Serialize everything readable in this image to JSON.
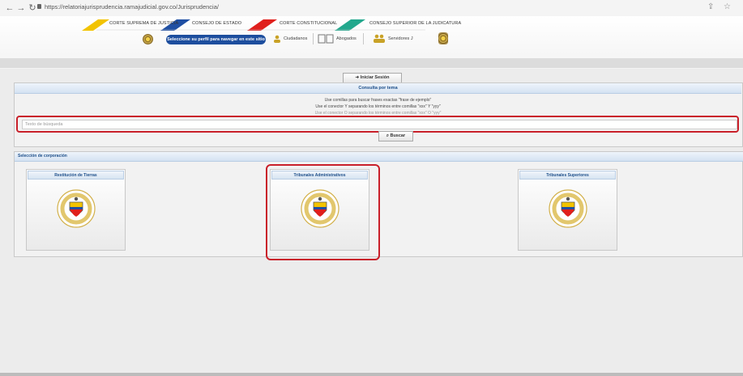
{
  "browser": {
    "url": "https://relatoriajurisprudencia.ramajudicial.gov.co/Jurisprudencia/",
    "back_icon": "arrow-left-icon",
    "forward_icon": "arrow-right-icon",
    "reload_icon": "reload-icon",
    "share_icon": "share-icon",
    "bookmark_icon": "star-icon"
  },
  "header": {
    "courts": [
      {
        "label": "CORTE SUPREMA DE JUSTICIA",
        "color": "#f2c300"
      },
      {
        "label": "CONSEJO DE ESTADO",
        "color": "#1f4fa3"
      },
      {
        "label": "CORTE CONSTITUCIONAL",
        "color": "#e0201d"
      },
      {
        "label": "CONSEJO SUPERIOR DE LA JUDICATURA",
        "color": "#23a88d"
      }
    ],
    "profile_prompt": "Seleccione su perfil para navegar en este sitio",
    "profiles": [
      {
        "label": "Ciudadanos",
        "icon": "citizens-icon"
      },
      {
        "label": "Abogados",
        "icon": "lawyers-icon"
      },
      {
        "label": "Servidores J",
        "icon": "servants-icon"
      }
    ]
  },
  "login": {
    "label": "Iniciar Sesión",
    "icon": "arrow-right-icon"
  },
  "search": {
    "title": "Consulta por tema",
    "hints": [
      "Use comillas para buscar frases exactas \"frase de ejemplo\"",
      "Use el conector Y separando los términos entre comillas \"xxx\" Y \"yyy\"",
      "Use el conector O separando los términos entre comillas \"xxx\" O \"yyy\""
    ],
    "placeholder": "Texto de búsqueda",
    "button": "Buscar",
    "button_icon": "search-icon"
  },
  "corporations": {
    "title": "Selección de corporación",
    "items": [
      {
        "label": "Restitución de Tierras"
      },
      {
        "label": "Tribunales Administrativos"
      },
      {
        "label": "Tribunales Superiores"
      }
    ],
    "emblem_icon": "rama-judicial-emblem-icon",
    "emblem_text": "Rama Judicial · República de Colombia"
  },
  "colors": {
    "accent": "#1e4f8a",
    "highlight": "#c9202a",
    "pill": "#1d4e9e"
  }
}
